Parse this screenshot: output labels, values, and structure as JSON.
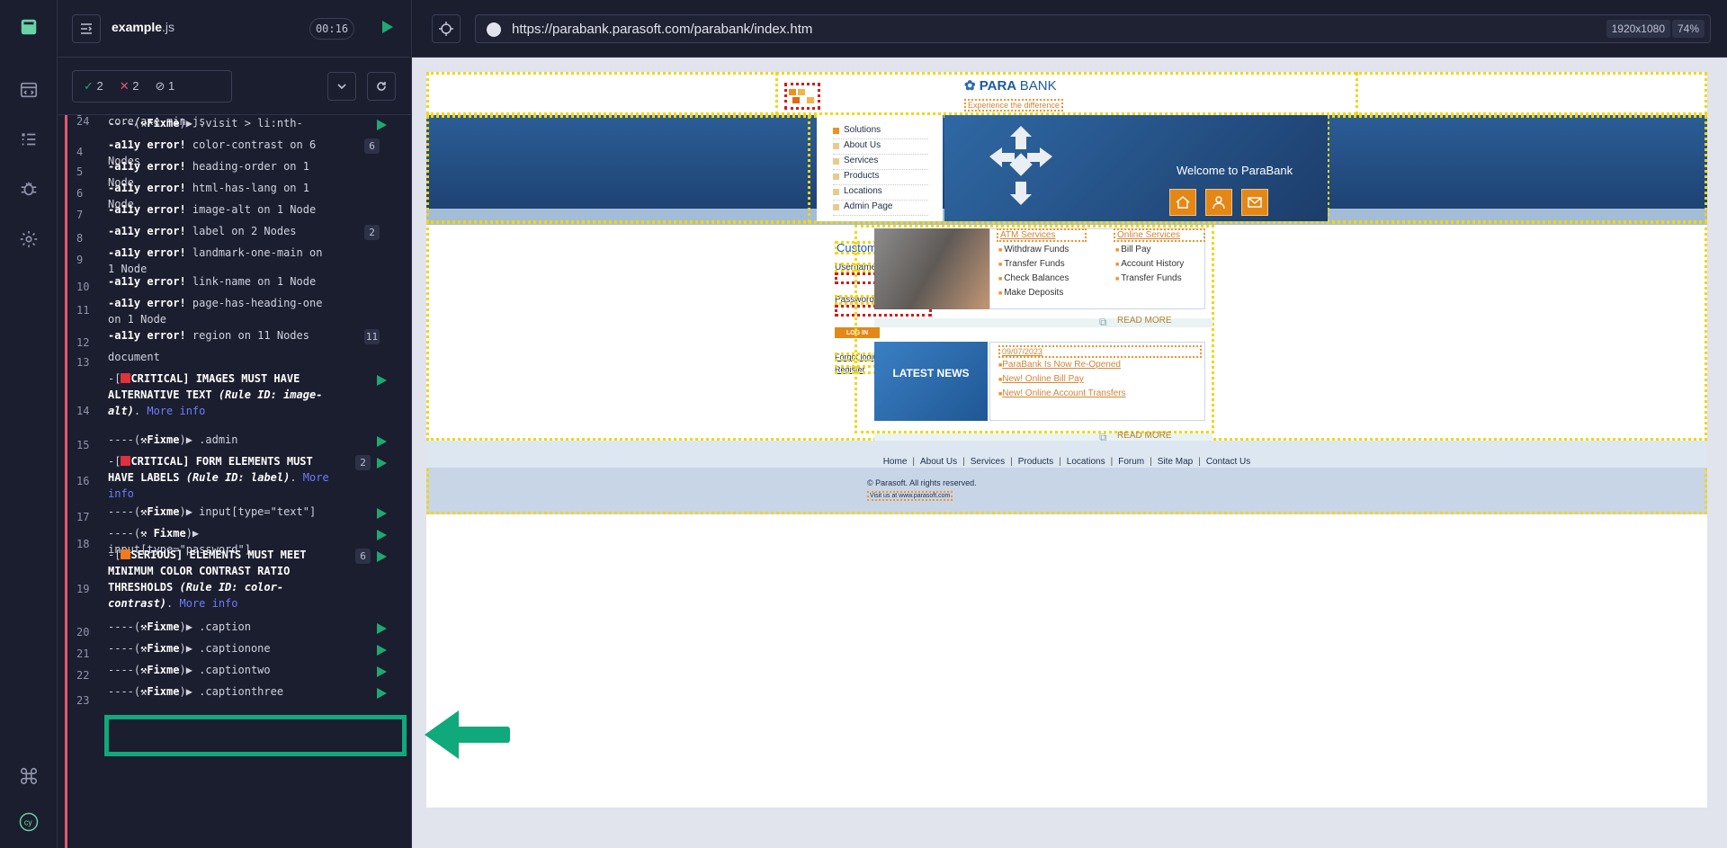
{
  "spec": {
    "name": "example",
    "ext": ".js",
    "time": "00:16"
  },
  "stats": {
    "passed": "2",
    "failed": "2",
    "pending": "1"
  },
  "url": "https://parabank.parasoft.com/parabank/index.htm",
  "viewport": {
    "size": "1920x1080",
    "zoom": "74%"
  },
  "log": [
    {
      "num": "3",
      "html": "<span class='kw'>readFile</span> ./node_modules/axe-core/axe.min.js"
    },
    {
      "num": "4",
      "html": "<span class='kw'>-a11y error!</span> color-contrast on 6 Nodes",
      "badge": "6"
    },
    {
      "num": "5",
      "html": "<span class='kw'>-a11y error!</span> heading-order on 1 Node"
    },
    {
      "num": "6",
      "html": "<span class='kw'>-a11y error!</span> html-has-lang on 1 Node"
    },
    {
      "num": "7",
      "html": "<span class='kw'>-a11y error!</span> image-alt on 1 Node"
    },
    {
      "num": "8",
      "html": "<span class='kw'>-a11y error!</span> label on 2 Nodes",
      "badge": "2"
    },
    {
      "num": "9",
      "html": "<span class='kw'>-a11y error!</span> landmark-one-main on 1 Node"
    },
    {
      "num": "10",
      "html": "<span class='kw'>-a11y error!</span> link-name on 1 Node"
    },
    {
      "num": "11",
      "html": "<span class='kw'>-a11y error!</span> page-has-heading-one on 1 Node"
    },
    {
      "num": "12",
      "html": "<span class='kw'>-a11y error!</span> region on 11 Nodes",
      "badge": "11"
    },
    {
      "num": "13",
      "html": "document"
    },
    {
      "num": "14",
      "html": "-[<span class='crit'></span><span class='kw'>CRITICAL] IMAGES MUST HAVE ALTERNATIVE TEXT</span> <span class='it'>(Rule ID: image-alt)</span>. <span class='lnk'>More info</span>",
      "play": true
    },
    {
      "num": "15",
      "html": "----(<span class='kw'>⚒Fixme</span>)▶ .admin",
      "play": true
    },
    {
      "num": "16",
      "html": "-[<span class='crit'></span><span class='kw'>CRITICAL] FORM ELEMENTS MUST HAVE LABELS</span> <span class='it'>(Rule ID: label)</span>. <span class='lnk'>More info</span>",
      "badge": "2",
      "play": true
    },
    {
      "num": "17",
      "html": "----(<span class='kw'>⚒Fixme</span>)▶ input[type=\"text\"]",
      "play": true
    },
    {
      "num": "18",
      "html": "----(<span class='kw'>⚒ Fixme</span>)▶ input[type=\"password\"]",
      "play": true
    },
    {
      "num": "19",
      "html": "-[<span class='serious'></span><span class='kw'>SERIOUS] ELEMENTS MUST MEET MINIMUM COLOR CONTRAST RATIO THRESHOLDS</span> <span class='it'>(Rule ID: color-contrast)</span>. <span class='lnk'>More info</span>",
      "badge": "6",
      "play": true
    },
    {
      "num": "20",
      "html": "----(<span class='kw'>⚒Fixme</span>)▶ .caption",
      "play": true
    },
    {
      "num": "21",
      "html": "----(<span class='kw'>⚒Fixme</span>)▶ .captionone",
      "play": true
    },
    {
      "num": "22",
      "html": "----(<span class='kw'>⚒Fixme</span>)▶ .captiontwo",
      "play": true
    },
    {
      "num": "23",
      "html": "----(<span class='kw'>⚒Fixme</span>)▶ .captionthree",
      "play": true
    },
    {
      "num": "24",
      "html": "----(<span class='kw'>⚒Fixme</span>)▶ .visit > li:nth-",
      "play": true
    }
  ],
  "parabank": {
    "brand": "PARA",
    "brand2": "BANK",
    "tagline": "Experience the difference",
    "menu": [
      "Solutions",
      "About Us",
      "Services",
      "Products",
      "Locations",
      "Admin Page"
    ],
    "welcome": "Welcome to ParaBank",
    "login_title": "Customer Login",
    "username_label": "Username",
    "password_label": "Password",
    "login_button": "LOG IN",
    "forgot": "Forgot login info?",
    "register": "Register",
    "atm_title": "ATM Services",
    "atm_items": [
      "Withdraw Funds",
      "Transfer Funds",
      "Check Balances",
      "Make Deposits"
    ],
    "online_title": "Online Services",
    "online_items": [
      "Bill Pay",
      "Account History",
      "Transfer Funds"
    ],
    "read_more": "READ MORE",
    "latest_news": "LATEST NEWS",
    "news_date": "09/07/2023",
    "news_items": [
      "ParaBank Is Now Re-Opened",
      "New! Online Bill Pay",
      "New! Online Account Transfers"
    ],
    "footer_links": [
      "Home",
      "About Us",
      "Services",
      "Products",
      "Locations",
      "Forum",
      "Site Map",
      "Contact Us"
    ],
    "copyright": "© Parasoft. All rights reserved.",
    "visit": "Visit us at www.parasoft.com"
  }
}
